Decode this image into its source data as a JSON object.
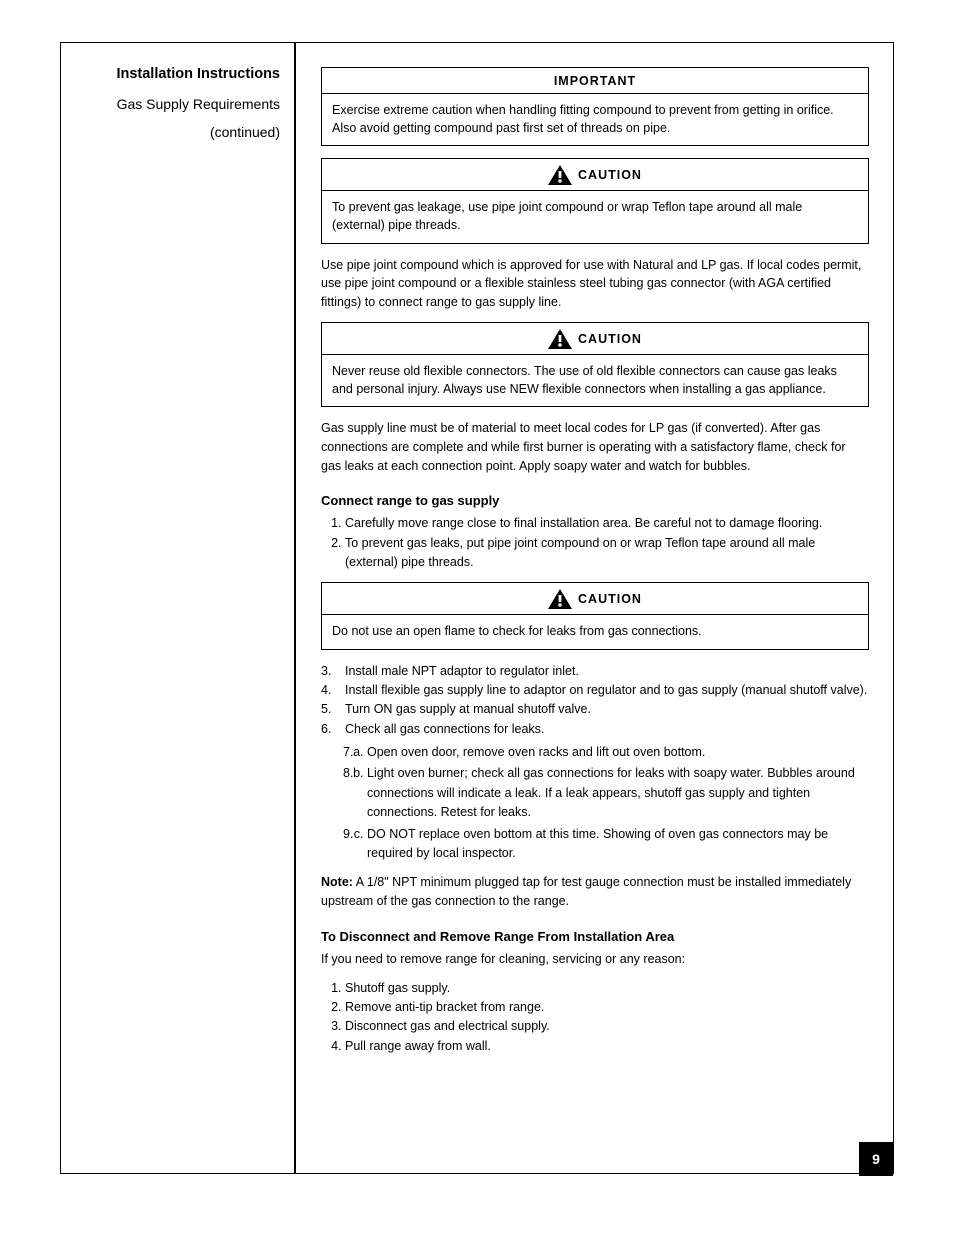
{
  "sidebar": {
    "title_bold": "Installation Instructions",
    "subs": [
      "Gas Supply Requirements",
      "(continued)"
    ]
  },
  "boxes": {
    "important": {
      "header": "IMPORTANT",
      "body": "Exercise extreme caution when handling fitting compound to prevent from getting in orifice. Also avoid getting compound past first set of threads on pipe."
    },
    "caution1": {
      "header": "CAUTION",
      "body": "To prevent gas leakage, use pipe joint compound or wrap Teflon tape around all male (external) pipe threads."
    },
    "caution2": {
      "header": "CAUTION",
      "body": "Never reuse old flexible connectors. The use of old flexible connectors can cause gas leaks and personal injury. Always use NEW flexible connectors when installing a gas appliance."
    },
    "caution3": {
      "header": "CAUTION",
      "body": "Do not use an open flame to check for leaks from gas connections."
    }
  },
  "paras": {
    "p1": "Use pipe joint compound which is approved for use with Natural and LP gas. If local codes permit, use pipe joint compound or a flexible stainless steel tubing gas connector (with AGA certified fittings) to connect range to gas supply line.",
    "p2": "Gas supply line must be of material to meet local codes for LP gas (if converted). After gas connections are complete and while first burner is operating with a satisfactory flame, check for gas leaks at each connection point. Apply soapy water and watch for bubbles."
  },
  "headings": {
    "h1": "Connect range to gas supply",
    "h2": "To Disconnect and Remove Range From Installation Area"
  },
  "steps_connect": [
    "Carefully move range close to final installation area. Be careful not to damage flooring.",
    "To prevent gas leaks, put pipe joint compound on or wrap Teflon tape around all male (external) pipe threads.",
    "Install male NPT adaptor to regulator inlet.",
    "Install flexible gas supply line to adaptor on regulator and to gas supply (manual shutoff valve).",
    "Turn ON gas supply at manual shutoff valve."
  ],
  "steps_check": [
    {
      "text": "Check all gas connections for leaks.",
      "subs": [
        "Open oven door, remove oven racks and lift out oven bottom.",
        "Light oven burner; check all gas connections for leaks with soapy water. Bubbles around connections will indicate a leak. If a leak appears, shutoff gas supply and tighten connections. Retest for leaks.",
        "DO NOT replace oven bottom at this time. Showing of oven gas connectors may be required by local inspector."
      ]
    }
  ],
  "note": {
    "label": "Note:",
    "text": "A 1/8\" NPT minimum plugged tap for test gauge connection must be installed immediately upstream of the gas connection to the range."
  },
  "disconnect_intro": "If you need to remove range for cleaning, servicing or any reason:",
  "disconnect_steps": [
    "Shutoff gas supply.",
    "Remove anti-tip bracket from range.",
    "Disconnect gas and electrical supply.",
    "Pull range away from wall."
  ],
  "page_number": "9"
}
